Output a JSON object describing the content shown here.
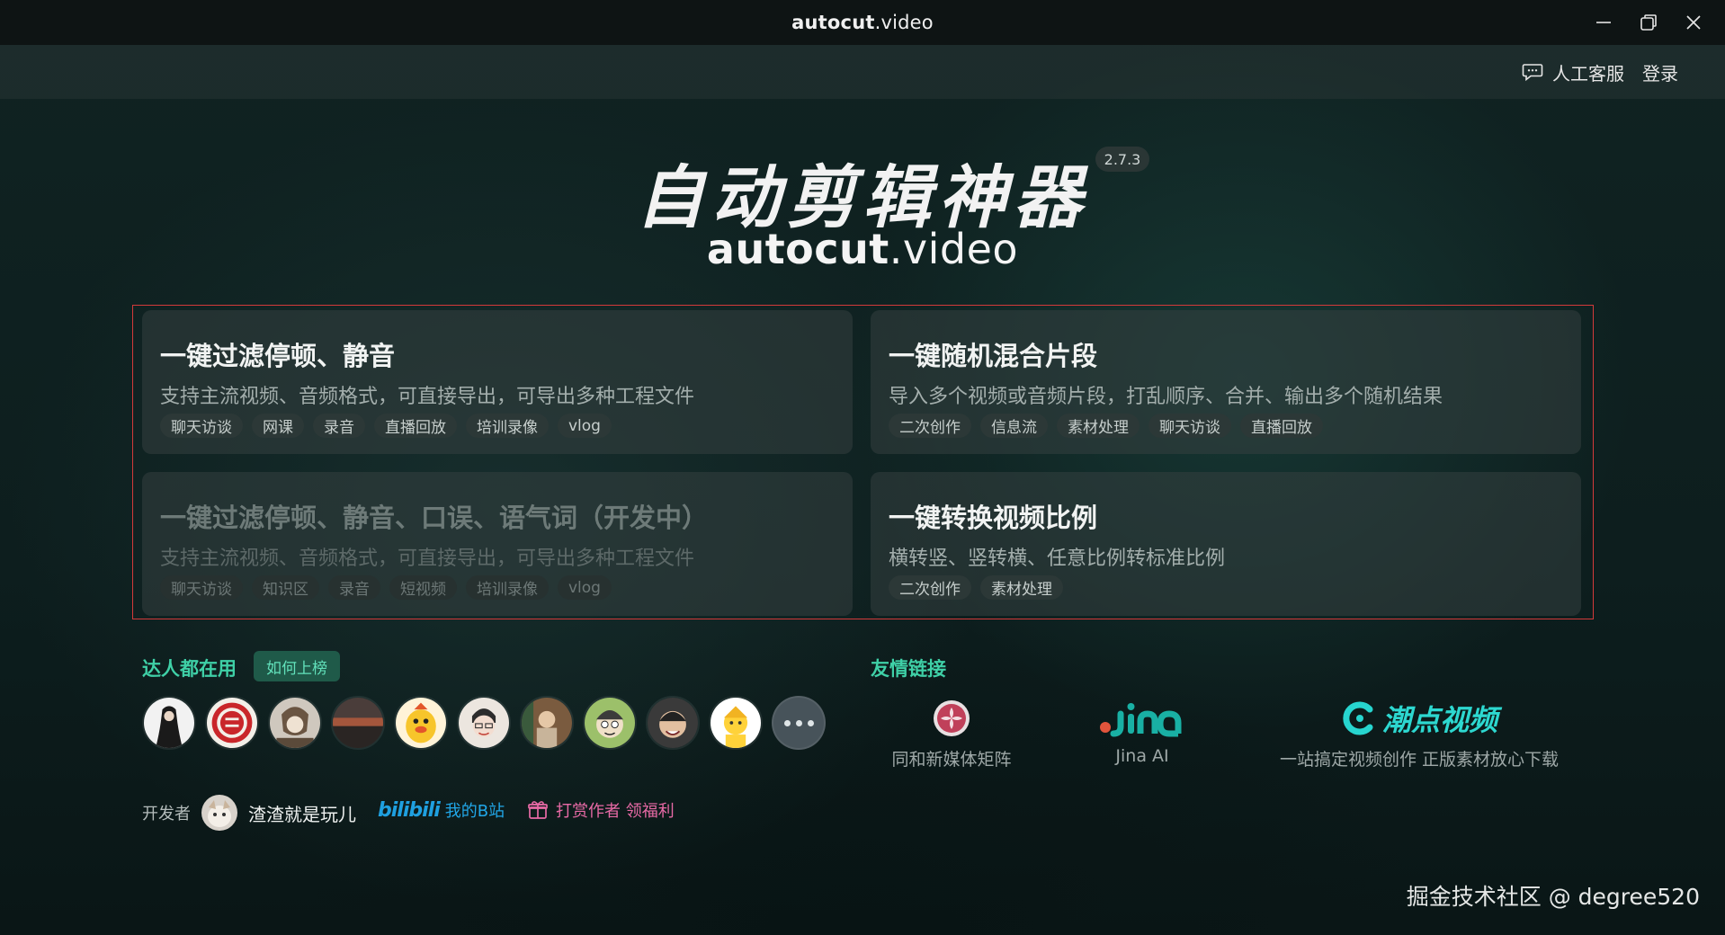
{
  "window": {
    "title_bold": "autocut",
    "title_rest": ".video"
  },
  "header": {
    "service_label": "人工客服",
    "login_label": "登录"
  },
  "hero": {
    "title": "自动剪辑神器",
    "version": "2.7.3",
    "subtitle_bold": "autocut",
    "subtitle_rest": ".video"
  },
  "features": [
    {
      "title": "一键过滤停顿、静音",
      "desc": "支持主流视频、音频格式，可直接导出，可导出多种工程文件",
      "tags": [
        "聊天访谈",
        "网课",
        "录音",
        "直播回放",
        "培训录像",
        "vlog"
      ],
      "disabled": false
    },
    {
      "title": "一键随机混合片段",
      "desc": "导入多个视频或音频片段，打乱顺序、合并、输出多个随机结果",
      "tags": [
        "二次创作",
        "信息流",
        "素材处理",
        "聊天访谈",
        "直播回放"
      ],
      "disabled": false
    },
    {
      "title": "一键过滤停顿、静音、口误、语气词（开发中）",
      "desc": "支持主流视频、音频格式，可直接导出，可导出多种工程文件",
      "tags": [
        "聊天访谈",
        "知识区",
        "录音",
        "短视频",
        "培训录像",
        "vlog"
      ],
      "disabled": true
    },
    {
      "title": "一键转换视频比例",
      "desc": "横转竖、竖转横、任意比例转标准比例",
      "tags": [
        "二次创作",
        "素材处理"
      ],
      "disabled": false
    }
  ],
  "users": {
    "title": "达人都在用",
    "howto_label": "如何上榜",
    "avatar_colors": [
      "#e9e9e9",
      "#f3f0ea",
      "#c9c3bb",
      "#5a4a44",
      "#f7c52b",
      "#e8e2dc",
      "#b47b56",
      "#7a9a4c",
      "#3f3f3f",
      "#ffd23a"
    ]
  },
  "links": {
    "title": "友情链接",
    "items": [
      {
        "name": "同和新媒体矩阵"
      },
      {
        "name": "Jina AI",
        "logo": "jina"
      },
      {
        "name": "一站搞定视频创作 正版素材放心下载",
        "logo": "潮点视频"
      }
    ]
  },
  "footer": {
    "dev_label": "开发者",
    "dev_name": "渣渣就是玩儿",
    "bili_logo": "bilibili",
    "bili_label": "我的B站",
    "reward_label": "打赏作者 领福利"
  },
  "watermark": "掘金技术社区 @ degree520"
}
